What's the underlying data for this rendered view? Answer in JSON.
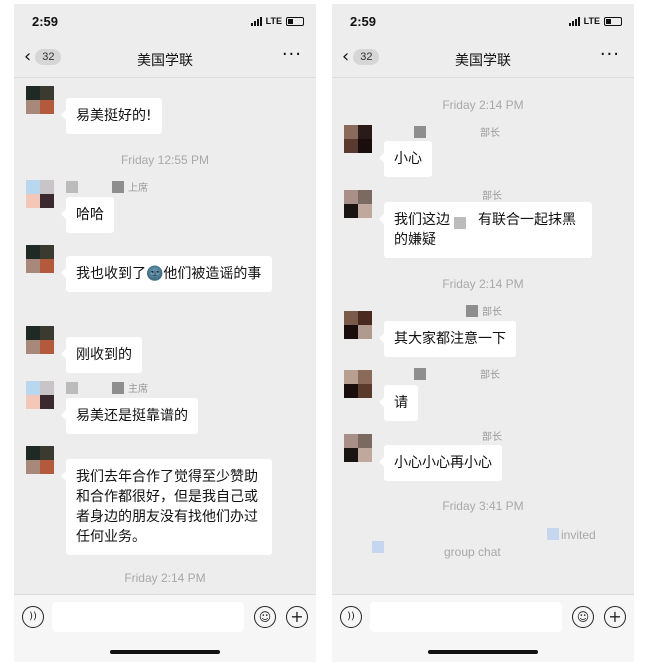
{
  "status": {
    "time": "2:59",
    "carrier": "LTE"
  },
  "nav": {
    "title": "美国学联",
    "badge": "32"
  },
  "left": {
    "messages": [
      {
        "text": "易美挺好的!"
      },
      {
        "timestamp": "Friday 12:55 PM"
      },
      {
        "sender": "上席",
        "text": "哈哈"
      },
      {
        "text": "我也收到了🌚他们被造谣的事"
      },
      {
        "text": "刚收到的"
      },
      {
        "sender": "主席",
        "text": "易美还是挺靠谱的"
      },
      {
        "text": "我们去年合作了觉得至少赞助和合作都很好，但是我自己或者身边的朋友没有找他们办过任何业务。"
      },
      {
        "timestamp": "Friday 2:14 PM"
      }
    ]
  },
  "right": {
    "messages": [
      {
        "timestamp": "Friday 2:14 PM"
      },
      {
        "sender": "部长",
        "text": "小心"
      },
      {
        "sender": "部长",
        "text": "我们这边　　有联合一起抹黑的嫌疑"
      },
      {
        "timestamp": "Friday 2:14 PM"
      },
      {
        "sender": "部长",
        "text": "其大家都注意一下"
      },
      {
        "sender": "部长",
        "text": "请"
      },
      {
        "sender": "部长",
        "text": "小心小心再小心"
      },
      {
        "timestamp": "Friday 3:41 PM"
      },
      {
        "invited": "invited",
        "group_chat": "group chat"
      }
    ]
  },
  "icons": {
    "voice": "voice-icon",
    "emoji": "emoji-icon",
    "plus": "plus-icon",
    "back": "chevron-left-icon",
    "more": "more-icon"
  },
  "colors": {
    "chat_bg": "#ededed",
    "bubble": "#ffffff",
    "timestamp": "#a8a8a8"
  }
}
